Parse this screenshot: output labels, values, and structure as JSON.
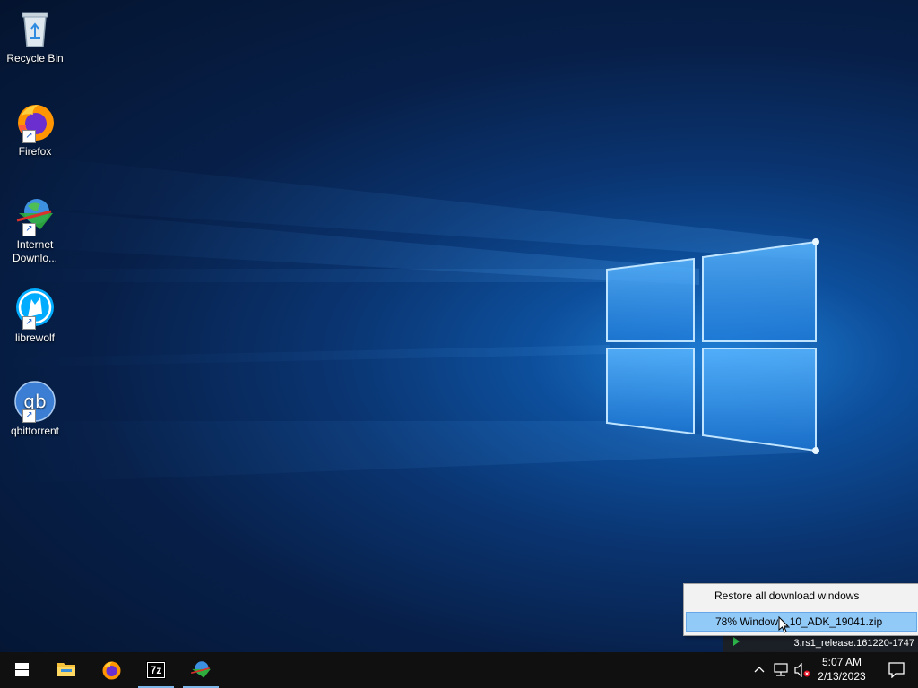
{
  "desktop": {
    "icons": [
      {
        "label": "Recycle Bin"
      },
      {
        "label": "Firefox"
      },
      {
        "label": "Internet Downlo..."
      },
      {
        "label": "librewolf"
      },
      {
        "label": "qbittorrent"
      }
    ]
  },
  "context_menu": {
    "items": [
      {
        "label": "Restore all download windows"
      },
      {
        "label": "78% Windows_10_ADK_19041.zip"
      }
    ]
  },
  "tooltip": {
    "text": "3.rs1_release.161220-1747"
  },
  "taskbar": {
    "apps": [
      {
        "icon": "file-explorer-icon"
      },
      {
        "icon": "firefox-icon"
      },
      {
        "icon": "7zip-icon",
        "label": "7z"
      },
      {
        "icon": "internet-download-manager-icon"
      }
    ],
    "tray": {
      "time": "5:07 AM",
      "date": "2/13/2023"
    }
  },
  "colors": {
    "menu_highlight": "#91c9f7",
    "taskbar_bg": "#101010",
    "active_indicator": "#7fb6e8"
  }
}
